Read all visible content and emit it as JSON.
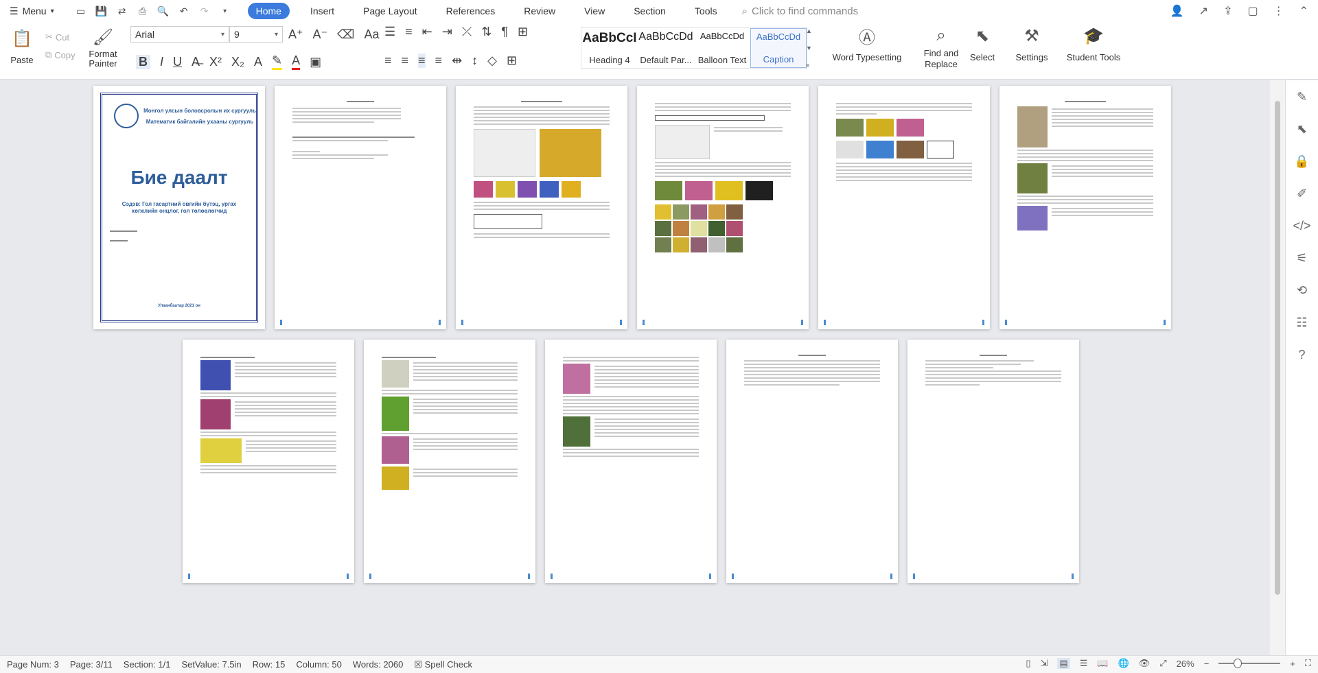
{
  "menubar": {
    "menu_label": "Menu",
    "tabs": [
      "Home",
      "Insert",
      "Page Layout",
      "References",
      "Review",
      "View",
      "Section",
      "Tools"
    ],
    "active_tab": "Home",
    "search_placeholder": "Click to find commands"
  },
  "ribbon": {
    "paste": "Paste",
    "cut": "Cut",
    "copy": "Copy",
    "format_painter": "Format Painter",
    "font_name": "Arial",
    "font_size": "9",
    "styles": [
      {
        "sample": "AaBbCcI",
        "label": "Heading 4"
      },
      {
        "sample": "AaBbCcDd",
        "label": "Default Par..."
      },
      {
        "sample": "AaBbCcDd",
        "label": "Balloon Text"
      },
      {
        "sample": "AaBbCcDd",
        "label": "Caption"
      }
    ],
    "word_typesetting": "Word Typesetting",
    "find_replace": "Find and Replace",
    "select": "Select",
    "settings": "Settings",
    "student_tools": "Student Tools"
  },
  "cover": {
    "line1": "Монгол улсын боловсролын их сургууль",
    "line2": "Математик байгалийн ухааны сургууль",
    "title": "Бие даалт",
    "subtitle": "Сэдэв: Гол гасартний овгийн бүтэц, ургах хөгжлийн онцлог, гол төлөөлөгчид",
    "place": "Улаанбаатар  2021 он"
  },
  "status": {
    "page_num": "Page Num: 3",
    "page": "Page: 3/11",
    "section": "Section: 1/1",
    "set_value": "SetValue: 7.5in",
    "row": "Row: 15",
    "column": "Column: 50",
    "words": "Words: 2060",
    "spell_check": "Spell Check",
    "zoom": "26%"
  },
  "colors": {
    "accent": "#3a7bdd",
    "cover_blue": "#2d5d9a"
  }
}
